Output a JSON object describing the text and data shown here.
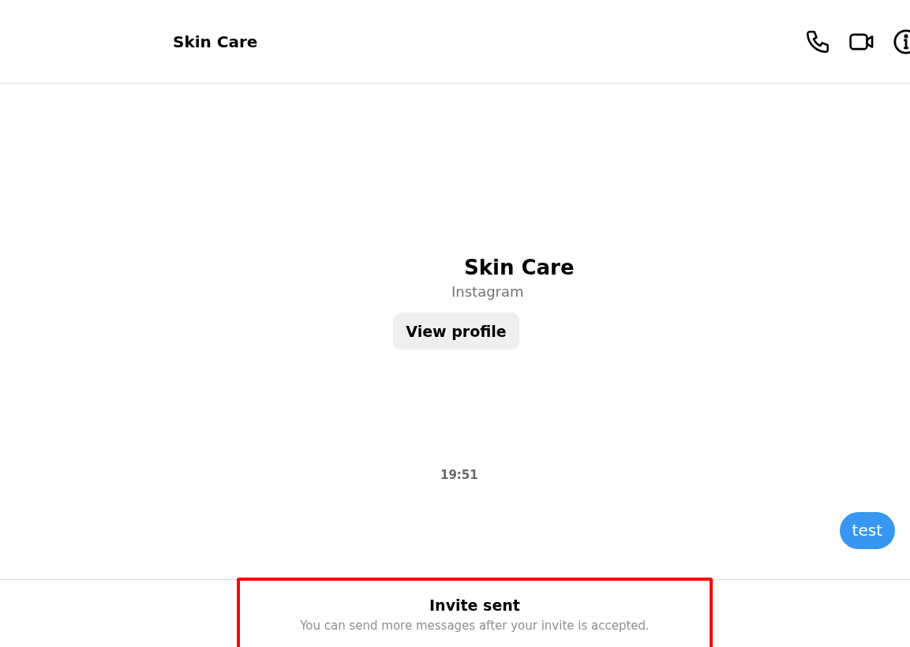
{
  "header": {
    "title": "Skin Care",
    "actions": [
      {
        "kind": "phone"
      },
      {
        "kind": "video"
      },
      {
        "kind": "info"
      }
    ]
  },
  "profile": {
    "name": "Skin Care",
    "source": "Instagram",
    "button": "View profile"
  },
  "messages": [
    {
      "kind": "timestamp",
      "text": "19:51"
    },
    {
      "kind": "outgoing",
      "text": "test"
    }
  ],
  "notice": {
    "title": "Invite sent",
    "subtitle": "You can send more messages after your invite is accepted.",
    "highlighted": true
  }
}
